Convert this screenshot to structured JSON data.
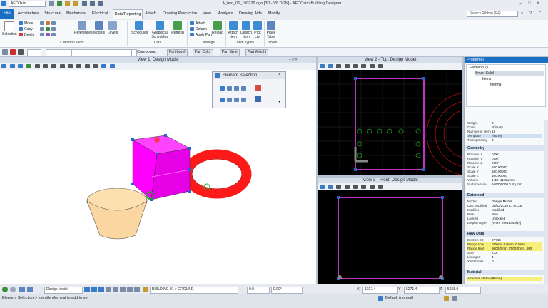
{
  "app": {
    "workspace": "AECOsim",
    "window_title": "A_test_06_190226.dgn [3D - V8 DGN] - AECOsim Building Designer"
  },
  "ribbon_tabs": [
    "File",
    "Architectural",
    "Structural",
    "Mechanical",
    "Electrical",
    "Data/Reporting",
    "Attach",
    "Drawing Production",
    "View",
    "Analysis",
    "Drawing Aids",
    "Modify"
  ],
  "active_tab": "Data/Reporting",
  "search_placeholder": "Search Ribbon (F4)",
  "ribbon": {
    "selection": "Selection",
    "move": "Move",
    "copy": "Copy",
    "delete": "Delete",
    "references": "References",
    "models": "Models",
    "levels": "Levels",
    "common_tools": "Common Tools",
    "schedules": "Schedules",
    "graphical_schedules": "Graphical Schedules",
    "refresh": "Refresh",
    "data": "Data",
    "attach": "Attach",
    "detach": "Detach",
    "apply_part": "Apply Part",
    "reload": "Reload",
    "catalogs": "Catalogs",
    "attach_item": "Attach Item",
    "detach_item": "Detach Item",
    "pick_list": "Pick List",
    "item_types": "Item Types",
    "place_table": "Place Table",
    "tables": "Tables"
  },
  "attr_toolbar": {
    "compound": "Compound",
    "part_level": "Part Level",
    "part_color": "Part Color",
    "part_style": "Part Style",
    "part_weight": "Part Weight"
  },
  "views": {
    "v1": "View 1, Design Model",
    "v2": "View 2 - Top, Design Model",
    "v3": "View 3 - Front, Design Model"
  },
  "element_selection": {
    "title": "Element Selection"
  },
  "properties": {
    "title": "Properties",
    "tree": [
      "Elements (1)",
      "Smart Solid",
      "Items",
      "Triforma"
    ],
    "top_rows": [
      {
        "k": "Weight",
        "v": "0"
      },
      {
        "k": "Class",
        "v": "Primary"
      },
      {
        "k": "Number of elem",
        "v": "13"
      },
      {
        "k": "Template",
        "v": "(None)"
      },
      {
        "k": "Transparency",
        "v": "0"
      }
    ],
    "geometry": {
      "title": "Geometry",
      "rows": [
        {
          "k": "Rotation X",
          "v": "0.00°"
        },
        {
          "k": "Rotation Y",
          "v": "0.00°"
        },
        {
          "k": "Rotation Z",
          "v": "0.00°"
        },
        {
          "k": "Scale X",
          "v": "100.00000"
        },
        {
          "k": "Scale Y",
          "v": "100.00000"
        },
        {
          "k": "Scale Z",
          "v": "100.00000"
        },
        {
          "k": "Volume",
          "v": "1.4E+11 Cu.mm"
        },
        {
          "k": "Surface Area",
          "v": "166000000.0 Sq.mm"
        }
      ]
    },
    "extended": {
      "title": "Extended",
      "rows": [
        {
          "k": "Model",
          "v": "Design Model"
        },
        {
          "k": "Last Modified",
          "v": "05/02/2019 17:00:25"
        },
        {
          "k": "Modified",
          "v": "Modified"
        },
        {
          "k": "New",
          "v": "New"
        },
        {
          "k": "Locked",
          "v": "Unlocked"
        },
        {
          "k": "Display Style",
          "v": "(From View Display)"
        }
      ]
    },
    "raw_data": {
      "title": "Raw Data",
      "rows": [
        {
          "k": "Element ID",
          "v": "67746"
        },
        {
          "k": "Range Low",
          "v": "0.0mm, 0.0mm, 0.0mm"
        },
        {
          "k": "Range High",
          "v": "5000.0mm, 7000.0mm, 490"
        },
        {
          "k": "Size",
          "v": "212"
        },
        {
          "k": "Linkages",
          "v": "4"
        },
        {
          "k": "XAttributes",
          "v": "0"
        }
      ]
    },
    "material": {
      "title": "Material",
      "rows": [
        {
          "k": "Attached Material",
          "v": "(None)"
        }
      ]
    }
  },
  "bottom_bar": {
    "model": "Design Model",
    "level": "BUILDING 01 > GROUND",
    "val1": "0.0",
    "angle": "0.00°",
    "x": "1027.4",
    "y": "5271.4",
    "z": "5655.0"
  },
  "status": {
    "message": "Element Selection > Identify element to add to set",
    "display": "Default (normal)"
  },
  "colors": {
    "accent": "#1a6fc2",
    "cube": "#ff00ff",
    "torus": "#ff1a1a",
    "cone": "#fde0b0"
  }
}
